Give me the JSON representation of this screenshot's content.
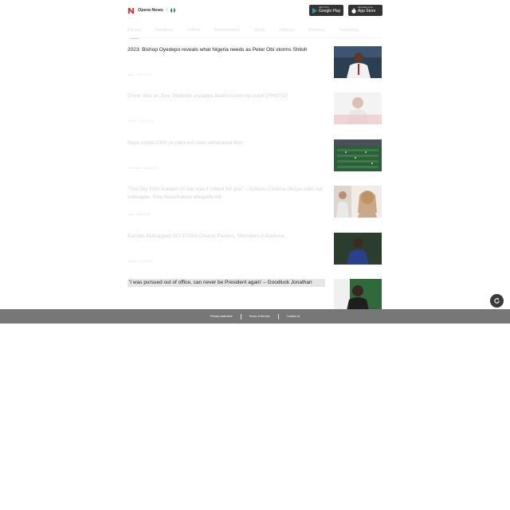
{
  "header": {
    "brand_name": "Opera News",
    "brand_separator": "|",
    "google_play": {
      "small": "GET IT ON",
      "big": "Google Play"
    },
    "app_store": {
      "small": "Download on the",
      "big": "App Store"
    }
  },
  "tabs": [
    {
      "label": "For you",
      "active": true
    },
    {
      "label": "Headlines",
      "active": false
    },
    {
      "label": "Politics",
      "active": false
    },
    {
      "label": "Entertainment",
      "active": false
    },
    {
      "label": "Sports",
      "active": false
    },
    {
      "label": "Lifestyle",
      "active": false
    },
    {
      "label": "Business",
      "active": false
    },
    {
      "label": "Technology",
      "active": false
    }
  ],
  "articles": [
    {
      "title": "2023: Bishop Oyedepo reveals what Nigeria needs as Peter Obi storms Shiloh",
      "meta": "News · 2023-09-01",
      "faded": false,
      "highlight": false,
      "thumb": "bishop-photo"
    },
    {
      "title": "Driver dies as Gov. Makinde escapes death in convoy crash [PHOTO]",
      "meta": "Tribune · 2023-09-01",
      "faded": true,
      "highlight": false,
      "thumb": "governor-photo"
    },
    {
      "title": "Reps probe CBN on planned cash withdrawal limit",
      "meta": "The Nation · 2023-09-01",
      "faded": true,
      "highlight": false,
      "thumb": "assembly-photo"
    },
    {
      "title": "\"You dey form madam on top loan I collect for you\" – Actress Chioma Okoye calls out colleague, Ona Nwachukwu allegedly-kd",
      "meta": "Legit · 2023-09-01",
      "faded": true,
      "highlight": false,
      "thumb": "actress-photo"
    },
    {
      "title": "Bandits Kidnapped 507 ECWA Church Pastors, Members in Kaduna",
      "meta": "Sahara · 2023-09-01",
      "faded": true,
      "highlight": false,
      "thumb": "pastor-photo"
    },
    {
      "title": "'I was pursued out of office, can never be President again' – Goodluck Jonathan",
      "meta": "",
      "faded": false,
      "highlight": true,
      "thumb": "jonathan-photo"
    }
  ],
  "footer": {
    "privacy": "Privacy statement",
    "terms": "Terms of Service",
    "contact": "Contact us"
  },
  "colors": {
    "brand_red": "#e8232c",
    "footer_bg": "#777777",
    "store_bg": "#333333"
  }
}
